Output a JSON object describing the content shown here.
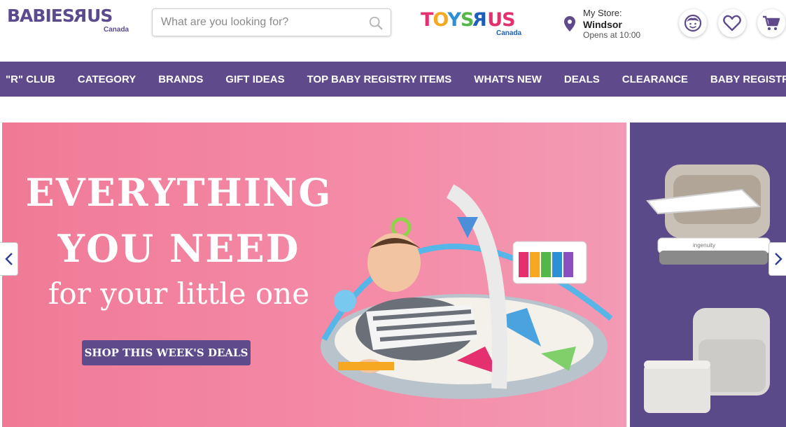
{
  "header": {
    "babies_logo": {
      "text": "BABIES",
      "r": "R",
      "us": "US",
      "sub": "Canada"
    },
    "search": {
      "placeholder": "What are you looking for?"
    },
    "toys_logo": {
      "toys": [
        "T",
        "O",
        "Y",
        "S"
      ],
      "r": "R",
      "us": "US",
      "sub": "Canada"
    },
    "store": {
      "label": "My Store:",
      "name": "Windsor",
      "hours": "Opens at 10:00"
    },
    "icons": [
      "account-icon",
      "heart-icon",
      "cart-icon"
    ]
  },
  "nav": {
    "items": [
      "\"R\" CLUB",
      "CATEGORY",
      "BRANDS",
      "GIFT IDEAS",
      "TOP BABY REGISTRY ITEMS",
      "WHAT'S NEW",
      "DEALS",
      "CLEARANCE",
      "BABY REGISTRY"
    ]
  },
  "hero": {
    "line1": "EVERYTHING",
    "line2": "YOU NEED",
    "line3": "for your little one",
    "cta": "SHOP THIS WEEK'S DEALS"
  },
  "side_panel": {
    "product_brand": "ingenuity"
  },
  "colors": {
    "brand_purple": "#5f4b8b",
    "hero_pink": "#f07a96",
    "cta_purple": "#5d4b8c"
  }
}
